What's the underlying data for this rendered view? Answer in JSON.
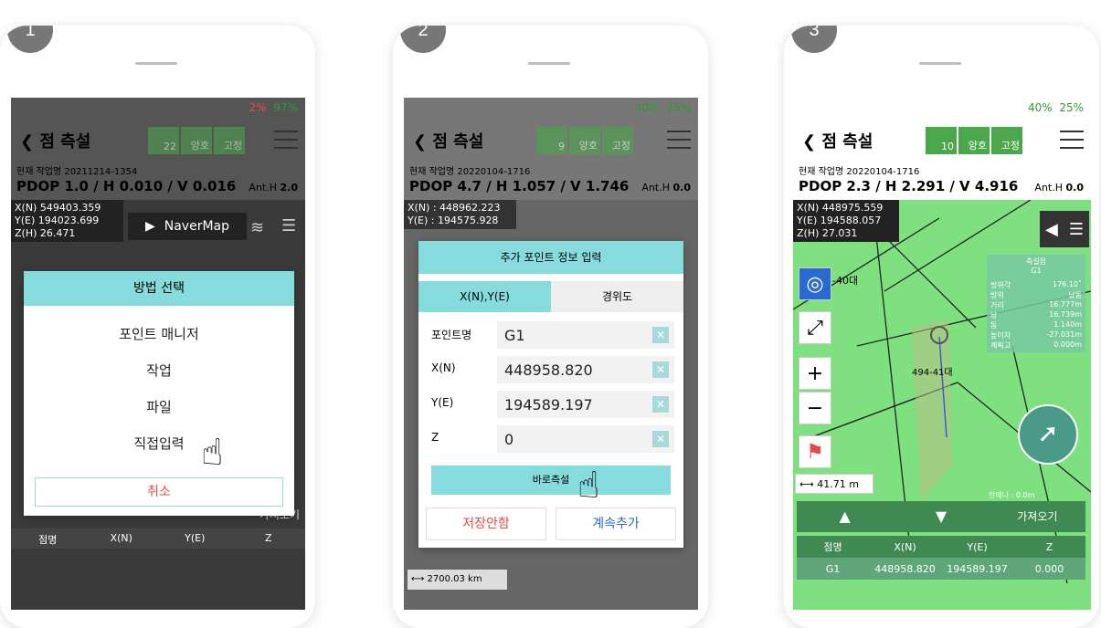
{
  "panels": [
    {
      "step": "1",
      "status": {
        "battery_gps": "2%",
        "battery": "97%"
      },
      "header": {
        "back_label": "점 측설",
        "gnss": "22",
        "correction": "양호",
        "state": "고정"
      },
      "gnss_labels": {
        "gnss": "GNSS",
        "correction": "보정",
        "state": "상태"
      },
      "project": "현재 작업명 20211214-1354",
      "pdop": "PDOP 1.0 / H 0.010 / V 0.016",
      "ant_h_label": "Ant.H",
      "ant_h": "2.0",
      "coords": {
        "x": "X(N) 549403.359",
        "y": "Y(E) 194023.699",
        "z": "Z(H) 26.471"
      },
      "map_button": "NaverMap",
      "dialog": {
        "title": "방법 선택",
        "items": [
          "포인트 매니저",
          "작업",
          "파일",
          "직접입력"
        ],
        "cancel": "취소"
      },
      "table_headers": [
        "점명",
        "X(N)",
        "Y(E)",
        "Z"
      ],
      "import_label": "가져오기"
    },
    {
      "step": "2",
      "status": {
        "battery_gps": "40%",
        "battery": "25%"
      },
      "header": {
        "back_label": "점 측설",
        "gnss": "9",
        "correction": "양호",
        "state": "고정"
      },
      "gnss_labels": {
        "gnss": "GNSS",
        "correction": "보정",
        "state": "상태"
      },
      "project": "현재 작업명 20220104-1716",
      "pdop": "PDOP 4.7 / H 1.057 / V 1.746",
      "ant_h_label": "Ant.H",
      "ant_h": "0.0",
      "coords": {
        "x": "X(N) : 448962.223",
        "y": "Y(E) : 194575.928"
      },
      "dialog": {
        "title": "추가 포인트 정보 입력",
        "tab_active": "X(N),Y(E)",
        "tab_other": "경위도",
        "fields": [
          {
            "label": "포인트명",
            "value": "G1"
          },
          {
            "label": "X(N)",
            "value": "448958.820"
          },
          {
            "label": "Y(E)",
            "value": "194589.197"
          },
          {
            "label": "Z",
            "value": "0"
          }
        ],
        "measure_button": "바로측설",
        "no_save": "저장안함",
        "continue_add": "계속추가"
      },
      "scale": "2700.03 km"
    },
    {
      "step": "3",
      "status": {
        "battery_gps": "40%",
        "battery": "25%"
      },
      "header": {
        "back_label": "점 측설",
        "gnss": "10",
        "correction": "양호",
        "state": "고정"
      },
      "gnss_labels": {
        "gnss": "GNSS",
        "correction": "보정",
        "state": "상태"
      },
      "project": "현재 작업명 20220104-1716",
      "pdop": "PDOP 2.3 / H 2.291 / V 4.916",
      "ant_h_label": "Ant.H",
      "ant_h": "0.0",
      "coords": {
        "x": "X(N) 448975.559",
        "y": "Y(E) 194588.057",
        "z": "Z(H) 27.031"
      },
      "parcels": [
        "494-38 대",
        "4-40대",
        "494-41대",
        "494"
      ],
      "info_panel": {
        "title": "측설점",
        "point": "G1",
        "rows": [
          {
            "label": "방위각",
            "value": "176.10˚"
          },
          {
            "label": "방위",
            "value": "남동"
          },
          {
            "label": "거리",
            "value": "16.777m"
          },
          {
            "label": "남",
            "value": "16.739m"
          },
          {
            "label": "동",
            "value": "1.140m"
          },
          {
            "label": "높이차",
            "value": "-27.031m"
          },
          {
            "label": "계획고",
            "value": "0.000m"
          }
        ]
      },
      "distance": "41.71 m",
      "height_label": "안테나 : 0.0m",
      "import_label": "가져오기",
      "table_headers": [
        "점명",
        "X(N)",
        "Y(E)",
        "Z"
      ],
      "table_row": [
        "G1",
        "448958.820",
        "194589.197",
        "0.000"
      ]
    }
  ],
  "colors": {
    "accent": "#86dcdc",
    "green": "#4aa84a",
    "map_green": "#7ee07e",
    "cancel": "#e14a4a",
    "blue": "#2a6ad0"
  }
}
